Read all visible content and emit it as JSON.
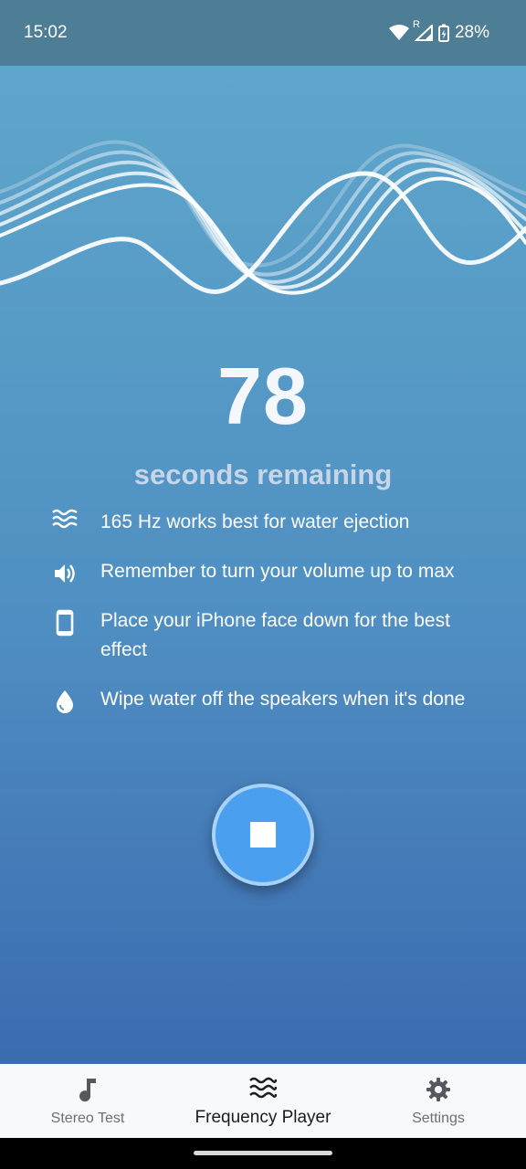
{
  "status_bar": {
    "time": "15:02",
    "battery": "28%",
    "network_indicator": "R",
    "icons": [
      "wifi-icon",
      "signal-icon",
      "battery-charging-icon"
    ]
  },
  "player": {
    "seconds_remaining": "78",
    "seconds_label": "seconds remaining"
  },
  "tips": [
    {
      "icon": "waves-icon",
      "text": "165 Hz works best for water ejection"
    },
    {
      "icon": "volume-icon",
      "text": "Remember to turn your volume up to max"
    },
    {
      "icon": "phone-icon",
      "text": "Place your iPhone face down for the best effect"
    },
    {
      "icon": "water-drop-icon",
      "text": "Wipe water off the speakers when it's done"
    }
  ],
  "stop_button": {
    "icon": "stop-icon"
  },
  "bottom_nav": {
    "items": [
      {
        "label": "Stereo Test",
        "icon": "music-note-icon",
        "active": false
      },
      {
        "label": "Frequency Player",
        "icon": "waves-icon",
        "active": true
      },
      {
        "label": "Settings",
        "icon": "gear-icon",
        "active": false
      }
    ]
  },
  "colors": {
    "status_bar": "#4e7d96",
    "gradient_top": "#5ea6cb",
    "gradient_bottom": "#3c6bb0",
    "stop_button": "#4aa0ee",
    "nav_background": "#f8f9fb"
  }
}
